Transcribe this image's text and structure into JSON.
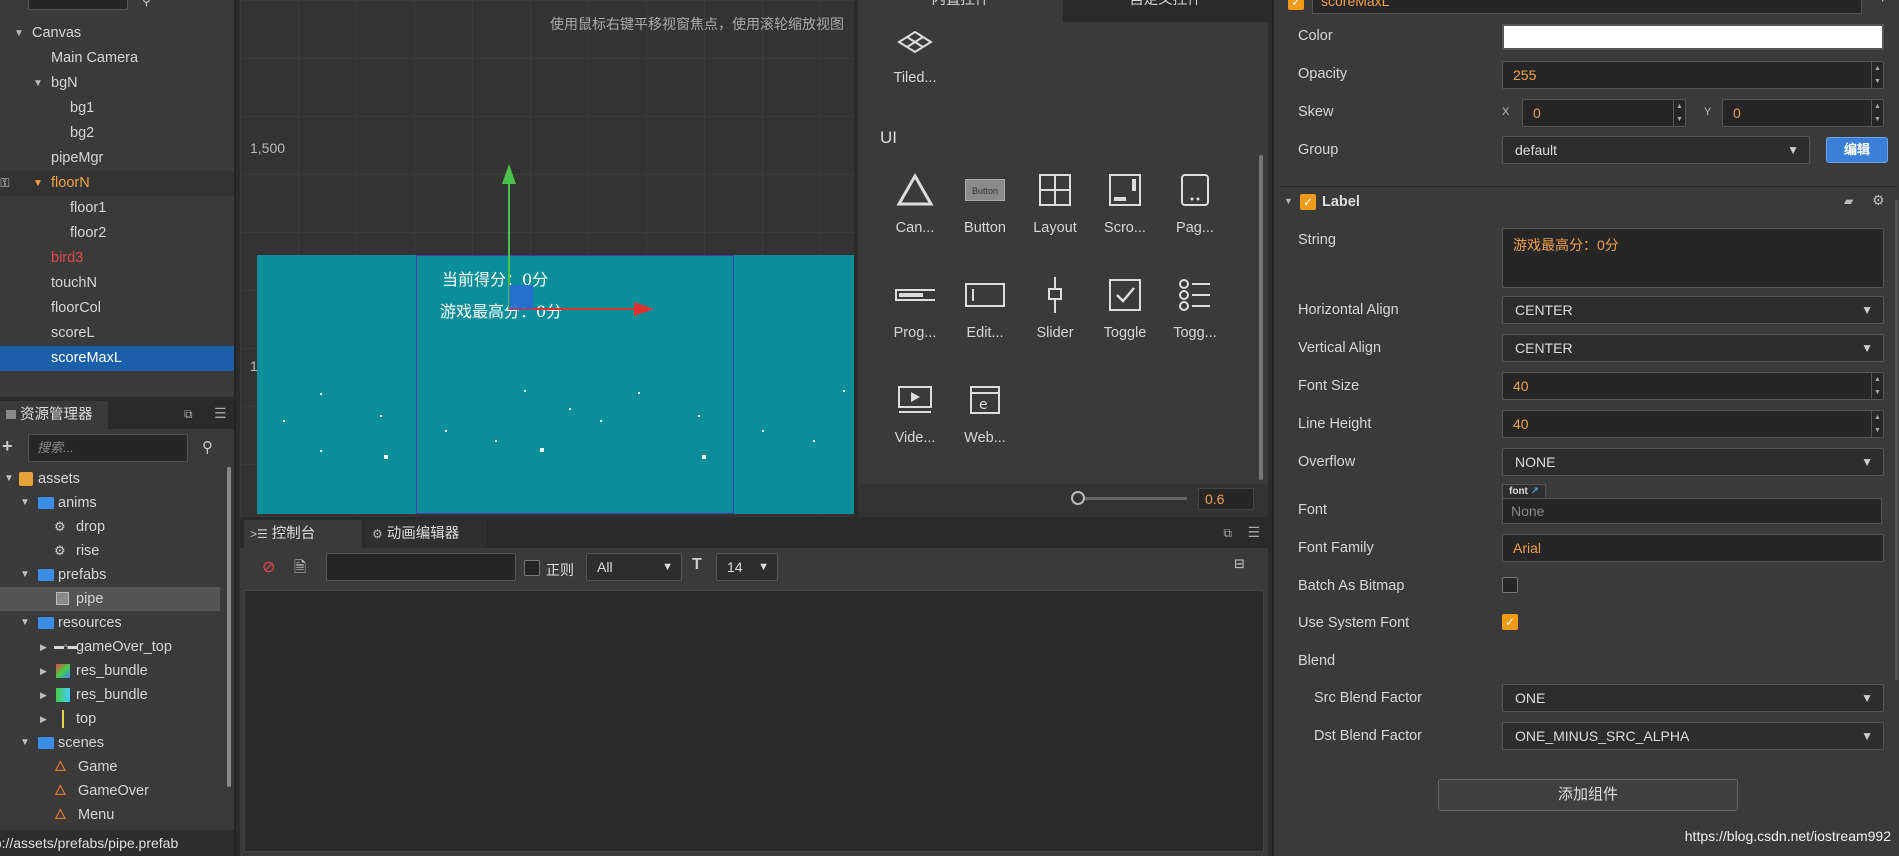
{
  "hierarchy": {
    "items": [
      {
        "label": "Canvas"
      },
      {
        "label": "Main Camera"
      },
      {
        "label": "bgN"
      },
      {
        "label": "bg1"
      },
      {
        "label": "bg2"
      },
      {
        "label": "pipeMgr"
      },
      {
        "label": "floorN"
      },
      {
        "label": "floor1"
      },
      {
        "label": "floor2"
      },
      {
        "label": "bird3"
      },
      {
        "label": "touchN"
      },
      {
        "label": "floorCol"
      },
      {
        "label": "scoreL"
      },
      {
        "label": "scoreMaxL"
      }
    ],
    "colors": {
      "selected_bg": "#1a5fa8",
      "orange": "#f0a24a",
      "red": "#e84a4a"
    }
  },
  "assets": {
    "tab_label": "资源管理器",
    "search_placeholder": "搜索...",
    "items": [
      {
        "label": "assets"
      },
      {
        "label": "anims"
      },
      {
        "label": "drop"
      },
      {
        "label": "rise"
      },
      {
        "label": "prefabs"
      },
      {
        "label": "pipe"
      },
      {
        "label": "resources"
      },
      {
        "label": "gameOver_top"
      },
      {
        "label": "res_bundle"
      },
      {
        "label": "res_bundle"
      },
      {
        "label": "top"
      },
      {
        "label": "scenes"
      },
      {
        "label": "Game"
      },
      {
        "label": "GameOver"
      },
      {
        "label": "Menu"
      }
    ],
    "status_path": "db://assets/prefabs/pipe.prefab"
  },
  "scene": {
    "hint": "使用鼠标右键平移视窗焦点，使用滚轮缩放视图",
    "ruler_1500": "1,500",
    "ruler_1": "1",
    "label_current": "当前得分：0分",
    "label_max": "游戏最高分：0分"
  },
  "widgets": {
    "tab_builtin": "内置控件",
    "tab_custom": "自定义控件",
    "tiled_label": "Tiled...",
    "section_ui": "UI",
    "items": [
      {
        "label": "Can..."
      },
      {
        "label": "Button"
      },
      {
        "label": "Layout"
      },
      {
        "label": "Scro..."
      },
      {
        "label": "Pag..."
      },
      {
        "label": "Prog..."
      },
      {
        "label": "Edit..."
      },
      {
        "label": "Slider"
      },
      {
        "label": "Toggle"
      },
      {
        "label": "Togg..."
      },
      {
        "label": "Vide..."
      },
      {
        "label": "Web..."
      }
    ],
    "button_icon_text": "Button",
    "zoom_value": "0.6"
  },
  "console": {
    "tab_console": "控制台",
    "tab_anim": "动画编辑器",
    "regex_label": "正则",
    "level_select": "All",
    "font_size_select": "14"
  },
  "inspector": {
    "node_name": "scoreMaxL",
    "color_label": "Color",
    "opacity_label": "Opacity",
    "opacity_value": "255",
    "skew_label": "Skew",
    "skew_x_label": "X",
    "skew_x_value": "0",
    "skew_y_label": "Y",
    "skew_y_value": "0",
    "group_label": "Group",
    "group_value": "default",
    "edit_button": "编辑",
    "label_component": "Label",
    "string_label": "String",
    "string_value": "游戏最高分：0分",
    "halign_label": "Horizontal Align",
    "halign_value": "CENTER",
    "valign_label": "Vertical Align",
    "valign_value": "CENTER",
    "fontsize_label": "Font Size",
    "fontsize_value": "40",
    "lineheight_label": "Line Height",
    "lineheight_value": "40",
    "overflow_label": "Overflow",
    "overflow_value": "NONE",
    "font_label": "Font",
    "font_tag": "font",
    "font_value": "None",
    "fontfamily_label": "Font Family",
    "fontfamily_value": "Arial",
    "bitmap_label": "Batch As Bitmap",
    "sysfont_label": "Use System Font",
    "blend_label": "Blend",
    "src_blend_label": "Src Blend Factor",
    "src_blend_value": "ONE",
    "dst_blend_label": "Dst Blend Factor",
    "dst_blend_value": "ONE_MINUS_SRC_ALPHA",
    "add_component": "添加组件",
    "watermark": "https://blog.csdn.net/iostream992"
  }
}
